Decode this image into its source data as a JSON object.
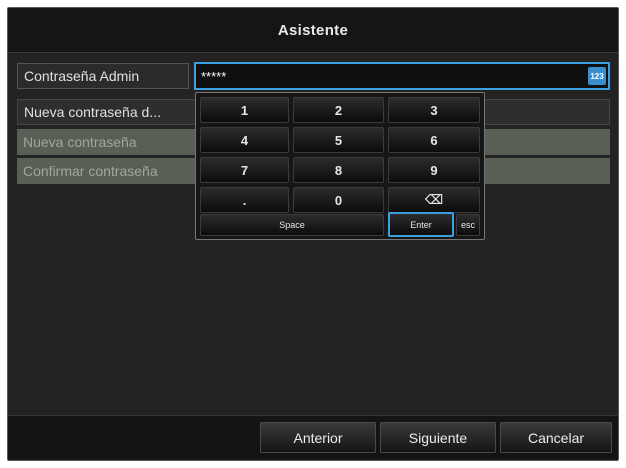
{
  "window": {
    "title": "Asistente"
  },
  "form": {
    "admin_label": "Contraseña Admin",
    "admin_value": "*****",
    "keyboard_toggle": "123",
    "new_password_header": "Nueva contraseña d...",
    "new_password_label": "Nueva contraseña",
    "confirm_password_label": "Confirmar contraseña"
  },
  "numpad": {
    "k1": "1",
    "k2": "2",
    "k3": "3",
    "k4": "4",
    "k5": "5",
    "k6": "6",
    "k7": "7",
    "k8": "8",
    "k9": "9",
    "dot": ".",
    "k0": "0",
    "backspace": "⌫",
    "space": "Space",
    "enter": "Enter",
    "esc": "esc"
  },
  "buttons": {
    "prev": "Anterior",
    "next": "Siguiente",
    "cancel": "Cancelar"
  },
  "colors": {
    "accent": "#3aa0e0",
    "disabled_row": "#5a5f55"
  }
}
